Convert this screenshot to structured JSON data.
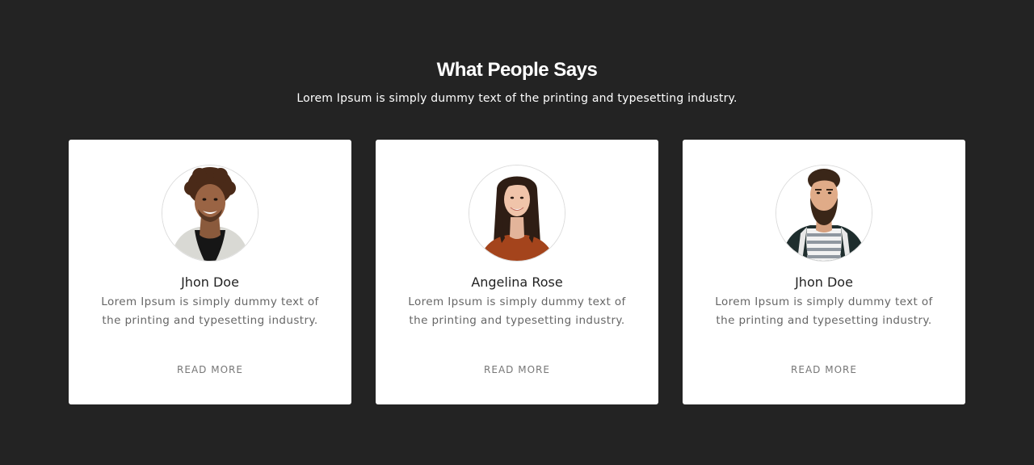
{
  "section": {
    "title": "What People Says",
    "subtitle": "Lorem Ipsum is simply dummy text of the printing and typesetting industry."
  },
  "testimonials": [
    {
      "name": "Jhon Doe",
      "text": "Lorem Ipsum is simply dummy text of the printing and typesetting industry.",
      "link_label": "READ MORE",
      "avatar_icon": "person-curly-hair-avatar"
    },
    {
      "name": "Angelina Rose",
      "text": "Lorem Ipsum is simply dummy text of the printing and typesetting industry.",
      "link_label": "READ MORE",
      "avatar_icon": "person-long-hair-avatar"
    },
    {
      "name": "Jhon Doe",
      "text": "Lorem Ipsum is simply dummy text of the printing and typesetting industry.",
      "link_label": "READ MORE",
      "avatar_icon": "person-bearded-avatar"
    }
  ],
  "colors": {
    "background": "#232323",
    "card": "#ffffff",
    "heading": "#ffffff",
    "name": "#222222",
    "body_text": "#666666",
    "link": "#777777"
  }
}
